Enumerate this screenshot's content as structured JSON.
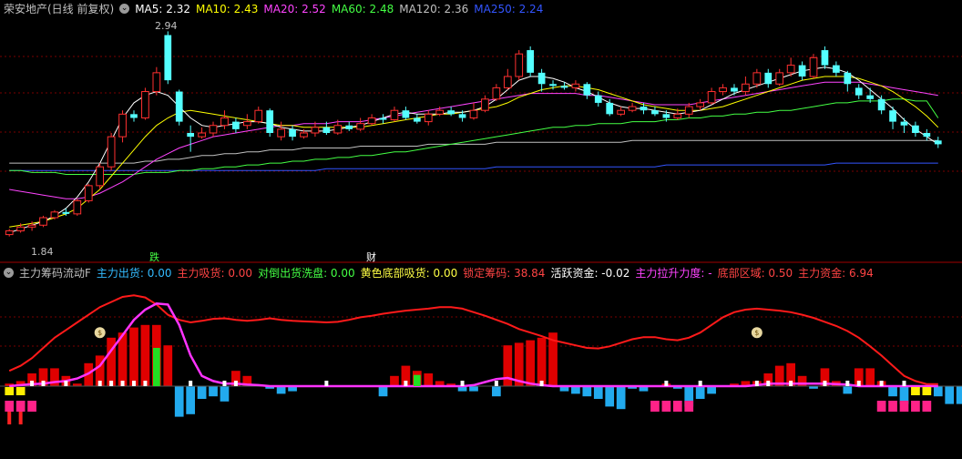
{
  "header": {
    "title": "荣安地产(日线 前复权)",
    "ma": [
      {
        "label": "MA5: 2.32",
        "color": "#ffffff"
      },
      {
        "label": "MA10: 2.43",
        "color": "#ffff00"
      },
      {
        "label": "MA20: 2.52",
        "color": "#ff44ff"
      },
      {
        "label": "MA60: 2.48",
        "color": "#44ff44"
      },
      {
        "label": "MA120: 2.36",
        "color": "#c0c0c0"
      },
      {
        "label": "MA250: 2.24",
        "color": "#3355ff"
      }
    ]
  },
  "indicator": {
    "title": "主力筹码流动F",
    "items": [
      {
        "label": "主力出货: 0.00",
        "color": "#33bbff"
      },
      {
        "label": "主力吸货: 0.00",
        "color": "#ff4444"
      },
      {
        "label": "对倒出货洗盘: 0.00",
        "color": "#44ff44"
      },
      {
        "label": "黄色底部吸货: 0.00",
        "color": "#ffff44"
      },
      {
        "label": "锁定筹码: 38.84",
        "color": "#ff4444"
      },
      {
        "label": "活跃资金: -0.02",
        "color": "#ffffff"
      },
      {
        "label": "主力拉升力度: -",
        "color": "#ff44ff"
      },
      {
        "label": "底部区域: 0.50",
        "color": "#ff4444"
      },
      {
        "label": "主力资金: 6.94",
        "color": "#ff4444"
      }
    ]
  },
  "markers": {
    "high_label": "2.94",
    "low_label": "1.84",
    "event1": "跌",
    "event2": "财",
    "bag": "$"
  },
  "colors": {
    "up": "#ff3030",
    "down": "#54ffff",
    "ma5": "#ffffff",
    "ma10": "#ffff00",
    "ma20": "#ff44ff",
    "ma60": "#44ff44",
    "ma120": "#c0c0c0",
    "ma250": "#3355ff",
    "red_line": "#ff1a1a",
    "magenta_line": "#ff33ff"
  },
  "chart_data": {
    "type": "candlestick",
    "ylim": [
      1.8,
      3.0
    ],
    "candles": [
      [
        1.86,
        1.88,
        1.85,
        1.89
      ],
      [
        1.88,
        1.9,
        1.87,
        1.92
      ],
      [
        1.9,
        1.91,
        1.88,
        1.93
      ],
      [
        1.91,
        1.95,
        1.9,
        1.96
      ],
      [
        1.95,
        1.98,
        1.94,
        1.99
      ],
      [
        1.98,
        1.97,
        1.96,
        2.0
      ],
      [
        1.97,
        2.04,
        1.96,
        2.05
      ],
      [
        2.04,
        2.12,
        2.03,
        2.13
      ],
      [
        2.12,
        2.22,
        2.1,
        2.24
      ],
      [
        2.22,
        2.38,
        2.2,
        2.4
      ],
      [
        2.38,
        2.5,
        2.35,
        2.52
      ],
      [
        2.5,
        2.48,
        2.46,
        2.52
      ],
      [
        2.48,
        2.62,
        2.47,
        2.64
      ],
      [
        2.62,
        2.72,
        2.6,
        2.75
      ],
      [
        2.92,
        2.68,
        2.66,
        2.94
      ],
      [
        2.62,
        2.46,
        2.44,
        2.63
      ],
      [
        2.4,
        2.38,
        2.3,
        2.44
      ],
      [
        2.38,
        2.4,
        2.37,
        2.43
      ],
      [
        2.4,
        2.44,
        2.38,
        2.46
      ],
      [
        2.44,
        2.48,
        2.42,
        2.52
      ],
      [
        2.46,
        2.42,
        2.4,
        2.48
      ],
      [
        2.44,
        2.46,
        2.42,
        2.5
      ],
      [
        2.46,
        2.52,
        2.45,
        2.54
      ],
      [
        2.52,
        2.4,
        2.38,
        2.53
      ],
      [
        2.38,
        2.42,
        2.36,
        2.46
      ],
      [
        2.42,
        2.38,
        2.36,
        2.44
      ],
      [
        2.38,
        2.4,
        2.37,
        2.42
      ],
      [
        2.4,
        2.43,
        2.38,
        2.46
      ],
      [
        2.43,
        2.4,
        2.39,
        2.46
      ],
      [
        2.4,
        2.44,
        2.39,
        2.47
      ],
      [
        2.44,
        2.42,
        2.41,
        2.46
      ],
      [
        2.42,
        2.45,
        2.41,
        2.48
      ],
      [
        2.45,
        2.48,
        2.44,
        2.5
      ],
      [
        2.48,
        2.47,
        2.45,
        2.5
      ],
      [
        2.47,
        2.52,
        2.46,
        2.54
      ],
      [
        2.52,
        2.48,
        2.47,
        2.54
      ],
      [
        2.48,
        2.46,
        2.45,
        2.5
      ],
      [
        2.46,
        2.5,
        2.44,
        2.52
      ],
      [
        2.5,
        2.52,
        2.49,
        2.54
      ],
      [
        2.52,
        2.5,
        2.49,
        2.54
      ],
      [
        2.5,
        2.48,
        2.46,
        2.52
      ],
      [
        2.48,
        2.52,
        2.47,
        2.56
      ],
      [
        2.52,
        2.58,
        2.51,
        2.6
      ],
      [
        2.58,
        2.64,
        2.57,
        2.66
      ],
      [
        2.64,
        2.7,
        2.63,
        2.74
      ],
      [
        2.7,
        2.82,
        2.68,
        2.84
      ],
      [
        2.84,
        2.72,
        2.7,
        2.86
      ],
      [
        2.72,
        2.66,
        2.62,
        2.74
      ],
      [
        2.66,
        2.65,
        2.63,
        2.68
      ],
      [
        2.65,
        2.64,
        2.63,
        2.67
      ],
      [
        2.64,
        2.66,
        2.62,
        2.68
      ],
      [
        2.66,
        2.6,
        2.58,
        2.67
      ],
      [
        2.6,
        2.56,
        2.54,
        2.62
      ],
      [
        2.56,
        2.5,
        2.49,
        2.58
      ],
      [
        2.5,
        2.52,
        2.49,
        2.54
      ],
      [
        2.52,
        2.54,
        2.51,
        2.56
      ],
      [
        2.54,
        2.52,
        2.5,
        2.56
      ],
      [
        2.52,
        2.5,
        2.49,
        2.54
      ],
      [
        2.5,
        2.48,
        2.46,
        2.52
      ],
      [
        2.48,
        2.5,
        2.47,
        2.53
      ],
      [
        2.5,
        2.54,
        2.48,
        2.56
      ],
      [
        2.54,
        2.56,
        2.52,
        2.58
      ],
      [
        2.56,
        2.62,
        2.55,
        2.64
      ],
      [
        2.62,
        2.64,
        2.6,
        2.66
      ],
      [
        2.64,
        2.62,
        2.6,
        2.66
      ],
      [
        2.62,
        2.66,
        2.6,
        2.7
      ],
      [
        2.66,
        2.72,
        2.64,
        2.74
      ],
      [
        2.72,
        2.66,
        2.64,
        2.74
      ],
      [
        2.66,
        2.72,
        2.65,
        2.74
      ],
      [
        2.72,
        2.76,
        2.7,
        2.8
      ],
      [
        2.76,
        2.7,
        2.68,
        2.78
      ],
      [
        2.7,
        2.8,
        2.69,
        2.82
      ],
      [
        2.84,
        2.76,
        2.74,
        2.86
      ],
      [
        2.76,
        2.72,
        2.7,
        2.78
      ],
      [
        2.72,
        2.66,
        2.62,
        2.73
      ],
      [
        2.64,
        2.6,
        2.58,
        2.66
      ],
      [
        2.6,
        2.58,
        2.56,
        2.64
      ],
      [
        2.58,
        2.52,
        2.5,
        2.6
      ],
      [
        2.52,
        2.46,
        2.42,
        2.54
      ],
      [
        2.46,
        2.44,
        2.4,
        2.48
      ],
      [
        2.44,
        2.4,
        2.38,
        2.46
      ],
      [
        2.4,
        2.38,
        2.36,
        2.42
      ],
      [
        2.36,
        2.34,
        2.32,
        2.38
      ]
    ],
    "ma5": [
      1.87,
      1.89,
      1.91,
      1.93,
      1.96,
      2.0,
      2.06,
      2.14,
      2.24,
      2.36,
      2.48,
      2.56,
      2.6,
      2.62,
      2.6,
      2.54,
      2.48,
      2.44,
      2.43,
      2.44,
      2.45,
      2.46,
      2.46,
      2.45,
      2.43,
      2.42,
      2.41,
      2.41,
      2.41,
      2.42,
      2.43,
      2.44,
      2.46,
      2.48,
      2.5,
      2.51,
      2.5,
      2.5,
      2.5,
      2.51,
      2.51,
      2.52,
      2.54,
      2.58,
      2.63,
      2.68,
      2.7,
      2.7,
      2.69,
      2.67,
      2.64,
      2.62,
      2.59,
      2.56,
      2.54,
      2.53,
      2.53,
      2.52,
      2.51,
      2.5,
      2.51,
      2.52,
      2.55,
      2.58,
      2.61,
      2.63,
      2.65,
      2.67,
      2.69,
      2.71,
      2.73,
      2.74,
      2.75,
      2.74,
      2.72,
      2.68,
      2.63,
      2.58,
      2.53,
      2.47,
      2.42,
      2.38,
      2.34
    ],
    "ma10": [
      1.9,
      1.91,
      1.92,
      1.93,
      1.95,
      1.97,
      2.0,
      2.05,
      2.1,
      2.17,
      2.24,
      2.31,
      2.38,
      2.44,
      2.48,
      2.51,
      2.52,
      2.51,
      2.5,
      2.49,
      2.48,
      2.47,
      2.46,
      2.45,
      2.44,
      2.44,
      2.43,
      2.43,
      2.43,
      2.43,
      2.43,
      2.43,
      2.44,
      2.45,
      2.46,
      2.47,
      2.48,
      2.49,
      2.5,
      2.5,
      2.51,
      2.52,
      2.53,
      2.54,
      2.56,
      2.59,
      2.61,
      2.63,
      2.64,
      2.65,
      2.65,
      2.64,
      2.63,
      2.61,
      2.59,
      2.57,
      2.55,
      2.54,
      2.53,
      2.52,
      2.52,
      2.52,
      2.53,
      2.54,
      2.56,
      2.58,
      2.6,
      2.62,
      2.64,
      2.66,
      2.68,
      2.69,
      2.7,
      2.7,
      2.7,
      2.69,
      2.67,
      2.65,
      2.62,
      2.58,
      2.54,
      2.49,
      2.43
    ],
    "ma20": [
      2.1,
      2.09,
      2.08,
      2.07,
      2.06,
      2.05,
      2.05,
      2.06,
      2.08,
      2.11,
      2.14,
      2.18,
      2.22,
      2.26,
      2.29,
      2.32,
      2.34,
      2.36,
      2.38,
      2.39,
      2.4,
      2.41,
      2.42,
      2.43,
      2.44,
      2.44,
      2.45,
      2.45,
      2.45,
      2.46,
      2.46,
      2.46,
      2.47,
      2.48,
      2.49,
      2.5,
      2.51,
      2.52,
      2.53,
      2.54,
      2.55,
      2.56,
      2.57,
      2.58,
      2.59,
      2.6,
      2.61,
      2.61,
      2.61,
      2.61,
      2.61,
      2.6,
      2.6,
      2.59,
      2.58,
      2.57,
      2.56,
      2.55,
      2.55,
      2.55,
      2.55,
      2.56,
      2.57,
      2.58,
      2.59,
      2.6,
      2.61,
      2.62,
      2.63,
      2.64,
      2.65,
      2.66,
      2.67,
      2.67,
      2.67,
      2.67,
      2.66,
      2.65,
      2.64,
      2.63,
      2.62,
      2.61,
      2.6
    ],
    "ma60": [
      2.2,
      2.2,
      2.19,
      2.19,
      2.19,
      2.18,
      2.18,
      2.18,
      2.18,
      2.18,
      2.18,
      2.18,
      2.19,
      2.19,
      2.19,
      2.2,
      2.2,
      2.21,
      2.21,
      2.22,
      2.22,
      2.23,
      2.23,
      2.24,
      2.24,
      2.25,
      2.25,
      2.26,
      2.26,
      2.27,
      2.27,
      2.28,
      2.28,
      2.29,
      2.3,
      2.3,
      2.31,
      2.32,
      2.33,
      2.34,
      2.35,
      2.36,
      2.37,
      2.38,
      2.39,
      2.4,
      2.41,
      2.42,
      2.43,
      2.43,
      2.44,
      2.44,
      2.45,
      2.45,
      2.45,
      2.46,
      2.46,
      2.46,
      2.47,
      2.47,
      2.48,
      2.48,
      2.49,
      2.49,
      2.5,
      2.5,
      2.51,
      2.51,
      2.52,
      2.52,
      2.53,
      2.54,
      2.55,
      2.56,
      2.56,
      2.57,
      2.57,
      2.57,
      2.58,
      2.58,
      2.57,
      2.57,
      2.48
    ],
    "ma120": [
      2.24,
      2.24,
      2.24,
      2.24,
      2.24,
      2.24,
      2.24,
      2.24,
      2.24,
      2.24,
      2.24,
      2.24,
      2.25,
      2.25,
      2.26,
      2.26,
      2.27,
      2.28,
      2.28,
      2.29,
      2.29,
      2.3,
      2.3,
      2.31,
      2.31,
      2.31,
      2.32,
      2.32,
      2.32,
      2.32,
      2.32,
      2.33,
      2.33,
      2.33,
      2.33,
      2.33,
      2.33,
      2.34,
      2.34,
      2.34,
      2.34,
      2.34,
      2.34,
      2.35,
      2.35,
      2.35,
      2.35,
      2.35,
      2.35,
      2.35,
      2.35,
      2.35,
      2.35,
      2.35,
      2.35,
      2.36,
      2.36,
      2.36,
      2.36,
      2.36,
      2.36,
      2.36,
      2.36,
      2.36,
      2.36,
      2.36,
      2.36,
      2.36,
      2.36,
      2.36,
      2.36,
      2.36,
      2.36,
      2.36,
      2.36,
      2.36,
      2.36,
      2.36,
      2.36,
      2.36,
      2.36,
      2.36,
      2.36
    ],
    "ma250": [
      2.2,
      2.2,
      2.2,
      2.2,
      2.2,
      2.2,
      2.2,
      2.2,
      2.2,
      2.2,
      2.2,
      2.2,
      2.2,
      2.2,
      2.2,
      2.2,
      2.2,
      2.2,
      2.2,
      2.2,
      2.2,
      2.2,
      2.2,
      2.2,
      2.2,
      2.2,
      2.2,
      2.2,
      2.21,
      2.21,
      2.21,
      2.21,
      2.21,
      2.21,
      2.21,
      2.21,
      2.21,
      2.21,
      2.21,
      2.21,
      2.21,
      2.21,
      2.21,
      2.22,
      2.22,
      2.22,
      2.22,
      2.22,
      2.22,
      2.22,
      2.22,
      2.22,
      2.22,
      2.22,
      2.22,
      2.22,
      2.22,
      2.22,
      2.23,
      2.23,
      2.23,
      2.23,
      2.23,
      2.23,
      2.23,
      2.23,
      2.23,
      2.23,
      2.23,
      2.23,
      2.23,
      2.23,
      2.23,
      2.24,
      2.24,
      2.24,
      2.24,
      2.24,
      2.24,
      2.24,
      2.24,
      2.24,
      2.24
    ],
    "indicator_ylim": [
      -1,
      2
    ],
    "red_line": [
      0.3,
      0.4,
      0.55,
      0.75,
      0.95,
      1.1,
      1.25,
      1.4,
      1.55,
      1.65,
      1.75,
      1.78,
      1.74,
      1.6,
      1.4,
      1.3,
      1.25,
      1.28,
      1.32,
      1.33,
      1.3,
      1.28,
      1.3,
      1.33,
      1.3,
      1.28,
      1.27,
      1.26,
      1.25,
      1.26,
      1.3,
      1.35,
      1.38,
      1.42,
      1.45,
      1.48,
      1.5,
      1.52,
      1.55,
      1.55,
      1.52,
      1.45,
      1.38,
      1.3,
      1.22,
      1.12,
      1.05,
      0.98,
      0.9,
      0.85,
      0.8,
      0.75,
      0.74,
      0.78,
      0.85,
      0.92,
      0.96,
      0.96,
      0.92,
      0.9,
      0.95,
      1.05,
      1.2,
      1.35,
      1.45,
      1.5,
      1.52,
      1.5,
      1.48,
      1.45,
      1.4,
      1.34,
      1.26,
      1.18,
      1.08,
      0.95,
      0.78,
      0.6,
      0.4,
      0.2,
      0.1,
      0.04,
      0.04
    ],
    "magenta_line": [
      0.0,
      0.02,
      0.04,
      0.05,
      0.08,
      0.1,
      0.15,
      0.25,
      0.4,
      0.7,
      1.0,
      1.3,
      1.5,
      1.62,
      1.6,
      1.2,
      0.6,
      0.2,
      0.1,
      0.05,
      0.05,
      0.03,
      0.02,
      0.0,
      0.0,
      0.0,
      0.0,
      0.0,
      0.0,
      0.0,
      0.0,
      0.0,
      0.0,
      0.0,
      0.0,
      0.0,
      0.0,
      0.0,
      0.0,
      0.0,
      0.0,
      0.02,
      0.08,
      0.14,
      0.16,
      0.1,
      0.05,
      0.02,
      0.0,
      0.0,
      0.0,
      0.0,
      0.0,
      0.0,
      0.0,
      0.0,
      0.0,
      0.0,
      0.0,
      0.0,
      0.0,
      0.0,
      0.0,
      0.0,
      0.0,
      0.0,
      0.02,
      0.05,
      0.05,
      0.05,
      0.05,
      0.05,
      0.05,
      0.04,
      0.03,
      0.0,
      0.0,
      0.0,
      0.0,
      0.0,
      0.0,
      0.0,
      0.0
    ],
    "histogram": [
      0.05,
      0.1,
      0.25,
      0.35,
      0.35,
      0.2,
      0.05,
      0.45,
      0.6,
      0.95,
      1.05,
      1.15,
      1.2,
      1.2,
      0.8,
      -0.6,
      -0.55,
      -0.25,
      -0.2,
      -0.3,
      0.3,
      0.2,
      0.0,
      -0.05,
      -0.15,
      -0.1,
      0.0,
      0.0,
      0.0,
      0.0,
      0.0,
      0.0,
      0.0,
      -0.2,
      0.2,
      0.4,
      0.3,
      0.25,
      0.1,
      0.05,
      -0.1,
      -0.1,
      0.0,
      -0.2,
      0.8,
      0.85,
      0.9,
      0.95,
      1.05,
      -0.1,
      -0.15,
      -0.2,
      -0.25,
      -0.4,
      -0.45,
      -0.05,
      -0.1,
      0.0,
      0.05,
      -0.05,
      -0.4,
      -0.25,
      -0.15,
      0.0,
      0.05,
      0.1,
      0.1,
      0.25,
      0.4,
      0.45,
      0.2,
      -0.05,
      0.35,
      0.1,
      -0.15,
      0.35,
      0.35,
      0.1,
      -0.2,
      -0.35,
      -0.05,
      -0.1,
      -0.2,
      -0.35,
      -0.35,
      -0.1
    ]
  }
}
